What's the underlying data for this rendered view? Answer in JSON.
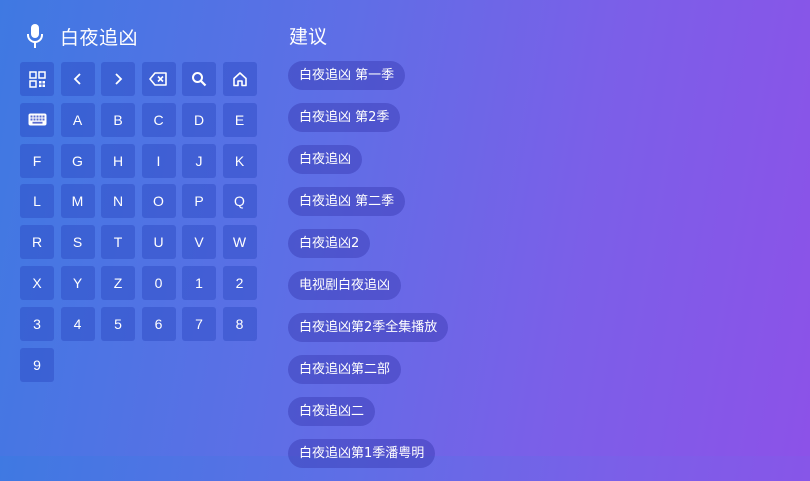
{
  "search": {
    "mic_icon": "microphone-icon",
    "query": "白夜追凶"
  },
  "keyboard": {
    "action_icons": [
      "qr-code-icon",
      "chevron-left-icon",
      "chevron-right-icon",
      "backspace-icon",
      "search-icon",
      "home-icon",
      "keyboard-icon"
    ],
    "letters": [
      "A",
      "B",
      "C",
      "D",
      "E",
      "F",
      "G",
      "H",
      "I",
      "J",
      "K",
      "L",
      "M",
      "N",
      "O",
      "P",
      "Q",
      "R",
      "S",
      "T",
      "U",
      "V",
      "W",
      "X",
      "Y",
      "Z",
      "0",
      "1",
      "2",
      "3",
      "4",
      "5",
      "6",
      "7",
      "8",
      "9"
    ]
  },
  "suggestions": {
    "title": "建议",
    "items": [
      "白夜追凶 第一季",
      "白夜追凶 第2季",
      "白夜追凶",
      "白夜追凶 第二季",
      "白夜追凶2",
      "电视剧白夜追凶",
      "白夜追凶第2季全集播放",
      "白夜追凶第二部",
      "白夜追凶二",
      "白夜追凶第1季潘粤明"
    ]
  },
  "colors": {
    "gradient_start": "#3f79e2",
    "gradient_end": "#8c52e8",
    "text": "#ffffff"
  }
}
